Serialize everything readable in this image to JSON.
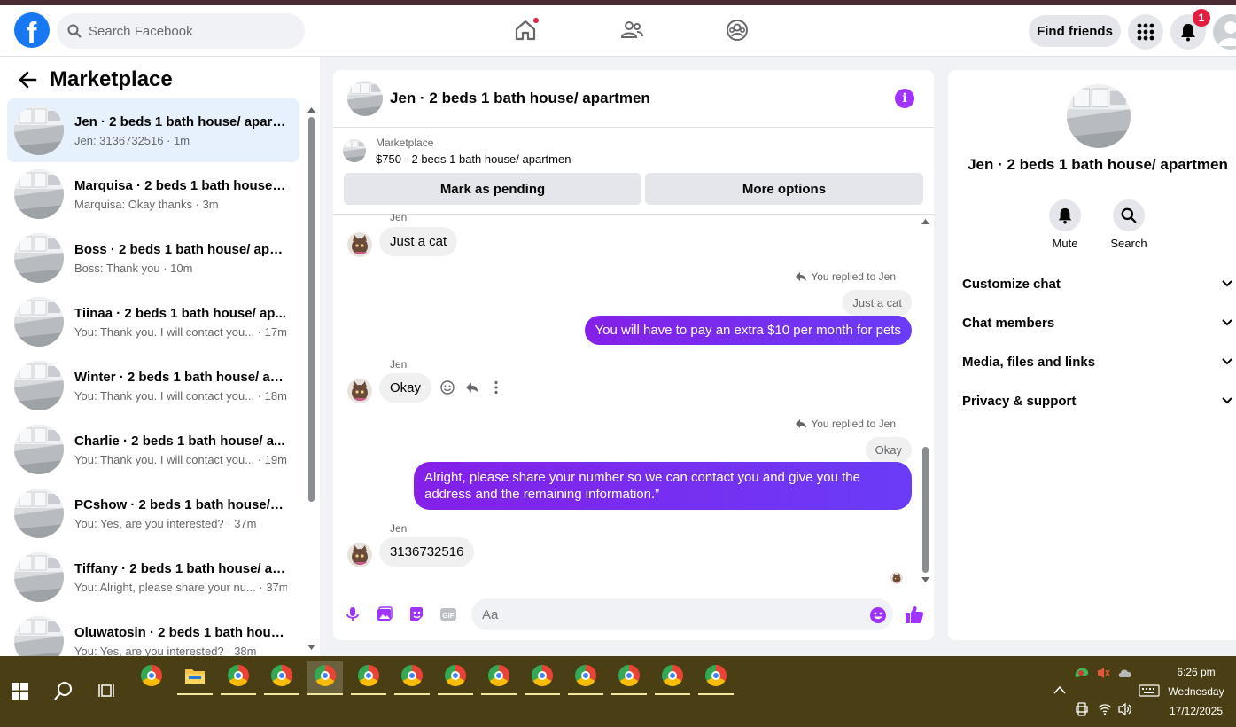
{
  "topbar": {
    "search_placeholder": "Search Facebook",
    "find_friends": "Find friends",
    "notif_count": "1"
  },
  "marketplace": {
    "title": "Marketplace",
    "conversations": [
      {
        "name": "Jen · 2 beds 1 bath house/ apart...",
        "preview": "Jen: 3136732516 · 1m",
        "active": true
      },
      {
        "name": "Marquisa · 2 beds 1 bath house/ ...",
        "preview": "Marquisa: Okay thanks · 3m"
      },
      {
        "name": "Boss · 2 beds 1 bath house/ apar...",
        "preview": "Boss: Thank you · 10m"
      },
      {
        "name": "Tiinaa · 2 beds 1 bath house/ ap...",
        "preview": "You: Thank you. I will contact you... · 17m"
      },
      {
        "name": "Winter · 2 beds 1 bath house/ ap...",
        "preview": "You: Thank you. I will contact you... · 18m"
      },
      {
        "name": "Charlie · 2 beds 1 bath house/ a...",
        "preview": "You: Thank you. I will contact you... · 19m"
      },
      {
        "name": "PCshow · 2 beds 1 bath house/ a...",
        "preview": "You: Yes, are you interested? · 37m"
      },
      {
        "name": "Tiffany · 2 beds 1 bath house/ ap...",
        "preview": "You: Alright, please share your nu... · 37m"
      },
      {
        "name": "Oluwatosin · 2 beds 1 bath hous...",
        "preview": "You: Yes, are you interested? · 38m"
      }
    ]
  },
  "chat": {
    "title": "Jen · 2 beds 1 bath house/ apartmen",
    "listing_source": "Marketplace",
    "listing_price": "$750 - 2 beds 1 bath house/ apartmen",
    "mark_pending": "Mark as pending",
    "more_options": "More options",
    "sender": "Jen",
    "msg1": "Just a cat",
    "replied_label": "You replied to Jen",
    "quote1": "Just a cat",
    "out1": "You will have to pay an extra $10 per month for pets",
    "msg2": "Okay",
    "quote2": "Okay",
    "out2": "Alright, please share your number so we can contact you and give you the address and the remaining information.”",
    "msg3": "3136732516",
    "composer_placeholder": "Aa"
  },
  "info": {
    "name": "Jen · 2 beds 1 bath house/ apartmen",
    "mute": "Mute",
    "search": "Search",
    "sections": [
      "Customize chat",
      "Chat members",
      "Media, files and links",
      "Privacy & support"
    ]
  },
  "taskbar": {
    "time": "6:26 pm",
    "day": "Wednesday",
    "date": "17/12/2025"
  },
  "colors": {
    "brand": "#1877f2",
    "bubble_out": "#7b2cf4",
    "taskbar": "#4a3f14"
  }
}
